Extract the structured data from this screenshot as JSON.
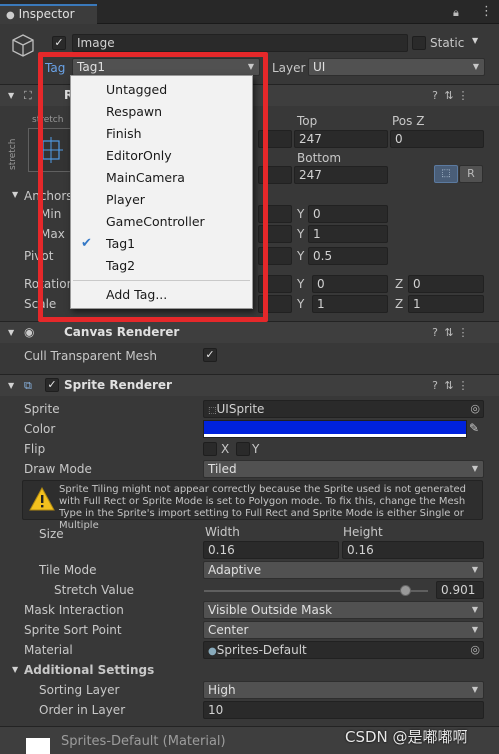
{
  "header": {
    "tab_label": "Inspector"
  },
  "object": {
    "name": "Image",
    "static_label": "Static",
    "tag_label": "Tag",
    "tag_value": "Tag1",
    "layer_label": "Layer",
    "layer_value": "UI"
  },
  "tag_menu": {
    "items": [
      "Untagged",
      "Respawn",
      "Finish",
      "EditorOnly",
      "MainCamera",
      "Player",
      "GameController",
      "Tag1",
      "Tag2"
    ],
    "selected": "Tag1",
    "add_tag": "Add Tag..."
  },
  "rect_transform": {
    "title": "R",
    "anchor_preset_top": "stretch",
    "anchor_preset_side": "stretch",
    "top_label": "Top",
    "top_value": "247",
    "posz_label": "Pos Z",
    "posz_value": "0",
    "bottom_label": "Bottom",
    "bottom_value": "247",
    "raw_button": "R",
    "anchors_label": "Anchors",
    "min_label": "Min",
    "max_label": "Max",
    "min_y": "0",
    "max_y": "1",
    "pivot_label": "Pivot",
    "pivot_y": "0.5",
    "rotation_label": "Rotation",
    "rotation_y": "0",
    "rotation_z": "0",
    "scale_label": "Scale",
    "scale_y": "1",
    "scale_z": "1",
    "y_label": "Y",
    "z_label": "Z"
  },
  "canvas_renderer": {
    "title": "Canvas Renderer",
    "cull_label": "Cull Transparent Mesh",
    "cull_checked": true
  },
  "sprite_renderer": {
    "title": "Sprite Renderer",
    "sprite_label": "Sprite",
    "sprite_value": "UISprite",
    "color_label": "Color",
    "color_hex": "#0022dd",
    "flip_label": "Flip",
    "flip_x": "X",
    "flip_y": "Y",
    "draw_mode_label": "Draw Mode",
    "draw_mode_value": "Tiled",
    "warning": "Sprite Tiling might not appear correctly because the Sprite used is not generated with Full Rect or Sprite Mode is set to Polygon mode. To fix this, change the Mesh Type in the Sprite's import setting to Full Rect and Sprite Mode is either Single or Multiple",
    "size_label": "Size",
    "width_label": "Width",
    "height_label": "Height",
    "width_value": "0.16",
    "height_value": "0.16",
    "tile_mode_label": "Tile Mode",
    "tile_mode_value": "Adaptive",
    "stretch_label": "Stretch Value",
    "stretch_value": "0.901",
    "stretch_fraction": 0.901,
    "mask_label": "Mask Interaction",
    "mask_value": "Visible Outside Mask",
    "sort_point_label": "Sprite Sort Point",
    "sort_point_value": "Center",
    "material_label": "Material",
    "material_value": "Sprites-Default",
    "additional_label": "Additional Settings",
    "sorting_layer_label": "Sorting Layer",
    "sorting_layer_value": "High",
    "order_label": "Order in Layer",
    "order_value": "10"
  },
  "footer": {
    "material_title": "Sprites-Default (Material)"
  },
  "watermark": "CSDN @是嘟嘟啊",
  "colors": {
    "highlight_border": "#e5282a",
    "tab_accent": "#3a79bb",
    "check_selected": "#3478c6"
  }
}
